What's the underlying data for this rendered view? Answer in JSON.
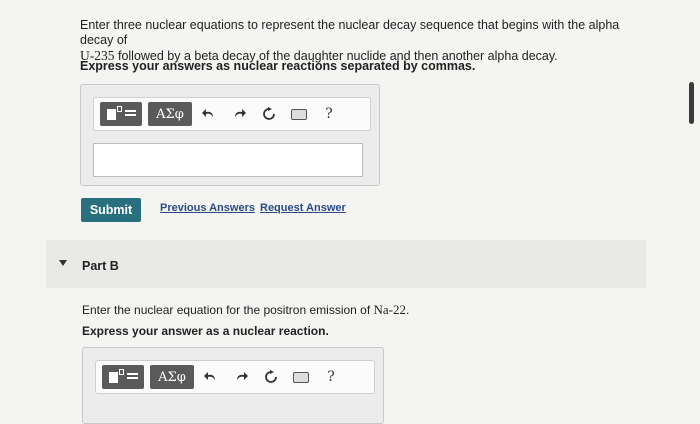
{
  "part_a": {
    "question_line1": "Enter three nuclear equations to represent the nuclear decay sequence that begins with the alpha decay of",
    "question_nuclide": "U-235",
    "question_line2_rest": " followed by a beta decay of the daughter nuclide and then another alpha decay.",
    "instruction": "Express your answers as nuclear reactions separated by commas.",
    "toolbar": {
      "templates_icon": "templates-icon",
      "greek_label": "ΑΣφ",
      "undo_icon": "undo-icon",
      "redo_icon": "redo-icon",
      "reset_icon": "reset-icon",
      "keyboard_icon": "keyboard-icon",
      "help_label": "?"
    },
    "answer_value": "",
    "submit_label": "Submit",
    "previous_answers_label": "Previous Answers",
    "request_answer_label": "Request Answer"
  },
  "part_b": {
    "label": "Part B",
    "question_prefix": "Enter the nuclear equation for the positron emission of ",
    "question_nuclide": "Na-22",
    "question_suffix": ".",
    "instruction": "Express your answer as a nuclear reaction.",
    "toolbar": {
      "greek_label": "ΑΣφ",
      "help_label": "?"
    }
  },
  "colors": {
    "submit_bg": "#2a6f7d",
    "link": "#2a4b87",
    "toolbar_button_bg": "#5a5a5a"
  }
}
